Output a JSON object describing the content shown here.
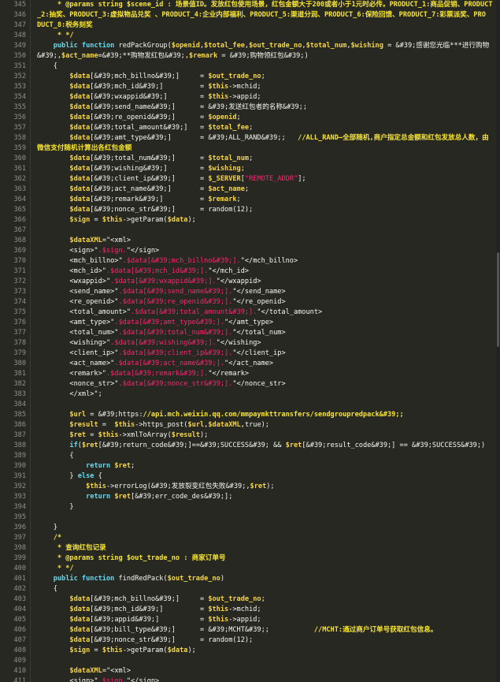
{
  "colors": {
    "background": "#272822",
    "line_number": "#8f908a",
    "default": "#f8f8f2",
    "comment": "#f8e531",
    "keyword": "#66d9ef",
    "variable": "#f5d547",
    "string": "#e6db74",
    "function": "#a6e22e",
    "red": "#f92672",
    "green": "#3bd35e",
    "blue_url": "#66d9ef",
    "constant": "#ae81ff"
  },
  "lines": [
    {
      "n": "345",
      "t": [
        [
          "comment",
          "     * @params string $scene_id : 场景值ID。发放红包使用场景，红包金额大于200或者小于1元时必传。PRODUCT_1:商品促销、PRODUCT"
        ]
      ]
    },
    {
      "n": "346",
      "t": [
        [
          "comment",
          "_2:抽奖、PRODUCT_3:虚拟物品兑奖 、PRODUCT_4:企业内部福利、PRODUCT_5:渠道分润、PRODUCT_6:保险回馈、PRODUCT_7:彩票派奖、PRO"
        ]
      ]
    },
    {
      "n": "347",
      "t": [
        [
          "comment",
          "DUCT_8:税务刻奖"
        ]
      ]
    },
    {
      "n": "348",
      "t": [
        [
          "comment",
          "     * */"
        ]
      ]
    },
    {
      "n": "349",
      "t": [
        [
          "default",
          "    "
        ],
        [
          "keyword",
          "public function "
        ],
        [
          "default",
          "redPackGroup("
        ],
        [
          "variable",
          "$openid"
        ],
        [
          "default",
          ","
        ],
        [
          "variable",
          "$total_fee"
        ],
        [
          "default",
          ","
        ],
        [
          "variable",
          "$out_trade_no"
        ],
        [
          "default",
          ","
        ],
        [
          "variable",
          "$total_num"
        ],
        [
          "default",
          ","
        ],
        [
          "variable",
          "$wishing"
        ],
        [
          "default",
          " = &#39;感谢您光临***进行购物"
        ]
      ]
    },
    {
      "n": "350",
      "t": [
        [
          "default",
          "&#39;,"
        ],
        [
          "variable",
          "$act_name"
        ],
        [
          "default",
          "=&#39;**购物发红包&#39;,"
        ],
        [
          "variable",
          "$remark"
        ],
        [
          "default",
          " = &#39;购物领红包&#39;)"
        ]
      ]
    },
    {
      "n": "351",
      "t": [
        [
          "default",
          "    {"
        ]
      ]
    },
    {
      "n": "352",
      "t": [
        [
          "default",
          "        "
        ],
        [
          "variable",
          "$data"
        ],
        [
          "default",
          "[&#39;mch_billno&#39;]     = "
        ],
        [
          "variable",
          "$out_trade_no"
        ],
        [
          "default",
          ";"
        ]
      ]
    },
    {
      "n": "353",
      "t": [
        [
          "default",
          "        "
        ],
        [
          "variable",
          "$data"
        ],
        [
          "default",
          "[&#39;mch_id&#39;]         = "
        ],
        [
          "variable",
          "$this"
        ],
        [
          "default",
          "->mchid;"
        ]
      ]
    },
    {
      "n": "354",
      "t": [
        [
          "default",
          "        "
        ],
        [
          "variable",
          "$data"
        ],
        [
          "default",
          "[&#39;wxappid&#39;]        = "
        ],
        [
          "variable",
          "$this"
        ],
        [
          "default",
          "->appid;"
        ]
      ]
    },
    {
      "n": "355",
      "t": [
        [
          "default",
          "        "
        ],
        [
          "variable",
          "$data"
        ],
        [
          "default",
          "[&#39;send_name&#39;]      = &#39;发送红包者的名称&#39;;"
        ]
      ]
    },
    {
      "n": "356",
      "t": [
        [
          "default",
          "        "
        ],
        [
          "variable",
          "$data"
        ],
        [
          "default",
          "[&#39;re_openid&#39;]      = "
        ],
        [
          "variable",
          "$openid"
        ],
        [
          "default",
          ";"
        ]
      ]
    },
    {
      "n": "357",
      "t": [
        [
          "default",
          "        "
        ],
        [
          "variable",
          "$data"
        ],
        [
          "default",
          "[&#39;total_amount&#39;]   = "
        ],
        [
          "variable",
          "$total_fee"
        ],
        [
          "default",
          ";"
        ]
      ]
    },
    {
      "n": "358",
      "t": [
        [
          "default",
          "        "
        ],
        [
          "variable",
          "$data"
        ],
        [
          "default",
          "[&#39;amt_type&#39;]       = &#39;ALL_RAND&#39;;   "
        ],
        [
          "comment",
          "//ALL_RAND—全部随机,商户指定总金额和红包发放总人数，由"
        ]
      ]
    },
    {
      "n": "359",
      "t": [
        [
          "comment",
          "微信支付随机计算出各红包金额"
        ]
      ]
    },
    {
      "n": "360",
      "t": [
        [
          "default",
          "        "
        ],
        [
          "variable",
          "$data"
        ],
        [
          "default",
          "[&#39;total_num&#39;]      = "
        ],
        [
          "variable",
          "$total_num"
        ],
        [
          "default",
          ";"
        ]
      ]
    },
    {
      "n": "361",
      "t": [
        [
          "default",
          "        "
        ],
        [
          "variable",
          "$data"
        ],
        [
          "default",
          "[&#39;wishing&#39;]        = "
        ],
        [
          "variable",
          "$wishing"
        ],
        [
          "default",
          ";"
        ]
      ]
    },
    {
      "n": "362",
      "t": [
        [
          "default",
          "        "
        ],
        [
          "variable",
          "$data"
        ],
        [
          "default",
          "[&#39;client_ip&#39;]      = "
        ],
        [
          "variable",
          "$_SERVER"
        ],
        [
          "default",
          "["
        ],
        [
          "red",
          "\"REMOTE_ADDR\""
        ],
        [
          "default",
          "];"
        ]
      ]
    },
    {
      "n": "363",
      "t": [
        [
          "default",
          "        "
        ],
        [
          "variable",
          "$data"
        ],
        [
          "default",
          "[&#39;act_name&#39;]       = "
        ],
        [
          "variable",
          "$act_name"
        ],
        [
          "default",
          ";"
        ]
      ]
    },
    {
      "n": "364",
      "t": [
        [
          "default",
          "        "
        ],
        [
          "variable",
          "$data"
        ],
        [
          "default",
          "[&#39;remark&#39;]         = "
        ],
        [
          "variable",
          "$remark"
        ],
        [
          "default",
          ";"
        ]
      ]
    },
    {
      "n": "365",
      "t": [
        [
          "default",
          "        "
        ],
        [
          "variable",
          "$data"
        ],
        [
          "default",
          "[&#39;nonce_str&#39;]      = random(12);"
        ]
      ]
    },
    {
      "n": "366",
      "t": [
        [
          "default",
          "        "
        ],
        [
          "variable",
          "$sign"
        ],
        [
          "default",
          " = "
        ],
        [
          "variable",
          "$this"
        ],
        [
          "default",
          "->getParam("
        ],
        [
          "variable",
          "$data"
        ],
        [
          "default",
          ");"
        ]
      ]
    },
    {
      "n": "367",
      "t": [
        [
          "default",
          ""
        ]
      ]
    },
    {
      "n": "368",
      "t": [
        [
          "default",
          "        "
        ],
        [
          "variable",
          "$dataXML"
        ],
        [
          "default",
          "=\"<xml>"
        ]
      ]
    },
    {
      "n": "369",
      "t": [
        [
          "default",
          "        <sign>\""
        ],
        [
          "red",
          ".$sign."
        ],
        [
          "default",
          "\"</sign>"
        ]
      ]
    },
    {
      "n": "370",
      "t": [
        [
          "default",
          "        <mch_billno>\""
        ],
        [
          "red",
          ".$data[&#39;mch_billno&#39;]."
        ],
        [
          "default",
          "\"</mch_billno>"
        ]
      ]
    },
    {
      "n": "371",
      "t": [
        [
          "default",
          "        <mch_id>\""
        ],
        [
          "red",
          ".$data[&#39;mch_id&#39;]."
        ],
        [
          "default",
          "\"</mch_id>"
        ]
      ]
    },
    {
      "n": "372",
      "t": [
        [
          "default",
          "        <wxappid>\""
        ],
        [
          "red",
          ".$data[&#39;wxappid&#39;]."
        ],
        [
          "default",
          "\"</wxappid>"
        ]
      ]
    },
    {
      "n": "373",
      "t": [
        [
          "default",
          "        <send_name>\""
        ],
        [
          "red",
          ".$data[&#39;send_name&#39;]."
        ],
        [
          "default",
          "\"</send_name>"
        ]
      ]
    },
    {
      "n": "374",
      "t": [
        [
          "default",
          "        <re_openid>\""
        ],
        [
          "red",
          ".$data[&#39;re_openid&#39;]."
        ],
        [
          "default",
          "\"</re_openid>"
        ]
      ]
    },
    {
      "n": "375",
      "t": [
        [
          "default",
          "        <total_amount>\""
        ],
        [
          "red",
          ".$data[&#39;total_amount&#39;]."
        ],
        [
          "default",
          "\"</total_amount>"
        ]
      ]
    },
    {
      "n": "376",
      "t": [
        [
          "default",
          "        <amt_type>\""
        ],
        [
          "red",
          ".$data[&#39;amt_type&#39;]."
        ],
        [
          "default",
          "\"</amt_type>"
        ]
      ]
    },
    {
      "n": "377",
      "t": [
        [
          "default",
          "        <total_num>\""
        ],
        [
          "red",
          ".$data[&#39;total_num&#39;]."
        ],
        [
          "default",
          "\"</total_num>"
        ]
      ]
    },
    {
      "n": "378",
      "t": [
        [
          "default",
          "        <wishing>\""
        ],
        [
          "red",
          ".$data[&#39;wishing&#39;]."
        ],
        [
          "default",
          "\"</wishing>"
        ]
      ]
    },
    {
      "n": "379",
      "t": [
        [
          "default",
          "        <client_ip>\""
        ],
        [
          "red",
          ".$data[&#39;client_ip&#39;]."
        ],
        [
          "default",
          "\"</client_ip>"
        ]
      ]
    },
    {
      "n": "380",
      "t": [
        [
          "default",
          "        <act_name>\""
        ],
        [
          "red",
          ".$data[&#39;act_name&#39;]."
        ],
        [
          "default",
          "\"</act_name>"
        ]
      ]
    },
    {
      "n": "381",
      "t": [
        [
          "default",
          "        <remark>\""
        ],
        [
          "red",
          ".$data[&#39;remark&#39;]."
        ],
        [
          "default",
          "\"</remark>"
        ]
      ]
    },
    {
      "n": "382",
      "t": [
        [
          "default",
          "        <nonce_str>\""
        ],
        [
          "red",
          ".$data[&#39;nonce_str&#39;]."
        ],
        [
          "default",
          "\"</nonce_str>"
        ]
      ]
    },
    {
      "n": "383",
      "t": [
        [
          "default",
          "        </xml>\";"
        ]
      ]
    },
    {
      "n": "384",
      "t": [
        [
          "default",
          ""
        ]
      ]
    },
    {
      "n": "385",
      "t": [
        [
          "default",
          "        "
        ],
        [
          "variable",
          "$url"
        ],
        [
          "default",
          " = &#39;https:"
        ],
        [
          "comment",
          "//api.mch.weixin.qq.com/mmpaymkttransfers/sendgroupredpack&#39;;"
        ]
      ]
    },
    {
      "n": "386",
      "t": [
        [
          "default",
          "        "
        ],
        [
          "variable",
          "$result"
        ],
        [
          "default",
          " =  "
        ],
        [
          "variable",
          "$this"
        ],
        [
          "default",
          "->https_post("
        ],
        [
          "variable",
          "$url"
        ],
        [
          "default",
          ","
        ],
        [
          "variable",
          "$dataXML"
        ],
        [
          "default",
          ",true);"
        ]
      ]
    },
    {
      "n": "387",
      "t": [
        [
          "default",
          "        "
        ],
        [
          "variable",
          "$ret"
        ],
        [
          "default",
          " = "
        ],
        [
          "variable",
          "$this"
        ],
        [
          "default",
          "->xmlToArray("
        ],
        [
          "variable",
          "$result"
        ],
        [
          "default",
          ");"
        ]
      ]
    },
    {
      "n": "388",
      "t": [
        [
          "default",
          "        "
        ],
        [
          "keyword",
          "if"
        ],
        [
          "default",
          "("
        ],
        [
          "variable",
          "$ret"
        ],
        [
          "default",
          "[&#39;return_code&#39;]==&#39;SUCCESS&#39; && "
        ],
        [
          "variable",
          "$ret"
        ],
        [
          "default",
          "[&#39;result_code&#39;] == &#39;SUCCESS&#39;)"
        ]
      ]
    },
    {
      "n": "389",
      "t": [
        [
          "default",
          "        {"
        ]
      ]
    },
    {
      "n": "390",
      "t": [
        [
          "default",
          "            "
        ],
        [
          "keyword",
          "return "
        ],
        [
          "variable",
          "$ret"
        ],
        [
          "default",
          ";"
        ]
      ]
    },
    {
      "n": "391",
      "t": [
        [
          "default",
          "        } "
        ],
        [
          "keyword",
          "else"
        ],
        [
          "default",
          " {"
        ]
      ]
    },
    {
      "n": "392",
      "t": [
        [
          "default",
          "            "
        ],
        [
          "variable",
          "$this"
        ],
        [
          "default",
          "->errorLog(&#39;发放裂变红包失败&#39;,"
        ],
        [
          "variable",
          "$ret"
        ],
        [
          "default",
          ");"
        ]
      ]
    },
    {
      "n": "393",
      "t": [
        [
          "default",
          "            "
        ],
        [
          "keyword",
          "return "
        ],
        [
          "variable",
          "$ret"
        ],
        [
          "default",
          "[&#39;err_code_des&#39;];"
        ]
      ]
    },
    {
      "n": "394",
      "t": [
        [
          "default",
          "        }"
        ]
      ]
    },
    {
      "n": "395",
      "t": [
        [
          "default",
          ""
        ]
      ]
    },
    {
      "n": "396",
      "t": [
        [
          "default",
          "    }"
        ]
      ]
    },
    {
      "n": "397",
      "t": [
        [
          "default",
          "    "
        ],
        [
          "comment",
          "/*"
        ]
      ]
    },
    {
      "n": "398",
      "t": [
        [
          "comment",
          "     * 查询红包记录"
        ]
      ]
    },
    {
      "n": "399",
      "t": [
        [
          "comment",
          "     * @params string $out_trade_no : 商家订单号"
        ]
      ]
    },
    {
      "n": "400",
      "t": [
        [
          "comment",
          "     * */"
        ]
      ]
    },
    {
      "n": "401",
      "t": [
        [
          "default",
          "    "
        ],
        [
          "keyword",
          "public function "
        ],
        [
          "default",
          "findRedPack("
        ],
        [
          "variable",
          "$out_trade_no"
        ],
        [
          "default",
          ")"
        ]
      ]
    },
    {
      "n": "402",
      "t": [
        [
          "default",
          "    {"
        ]
      ]
    },
    {
      "n": "403",
      "t": [
        [
          "default",
          "        "
        ],
        [
          "variable",
          "$data"
        ],
        [
          "default",
          "[&#39;mch_billno&#39;]     = "
        ],
        [
          "variable",
          "$out_trade_no"
        ],
        [
          "default",
          ";"
        ]
      ]
    },
    {
      "n": "404",
      "t": [
        [
          "default",
          "        "
        ],
        [
          "variable",
          "$data"
        ],
        [
          "default",
          "[&#39;mch_id&#39;]         = "
        ],
        [
          "variable",
          "$this"
        ],
        [
          "default",
          "->mchid;"
        ]
      ]
    },
    {
      "n": "405",
      "t": [
        [
          "default",
          "        "
        ],
        [
          "variable",
          "$data"
        ],
        [
          "default",
          "[&#39;appid&#39;]          = "
        ],
        [
          "variable",
          "$this"
        ],
        [
          "default",
          "->appid;"
        ]
      ]
    },
    {
      "n": "406",
      "t": [
        [
          "default",
          "        "
        ],
        [
          "variable",
          "$data"
        ],
        [
          "default",
          "[&#39;bill_type&#39;]      = &#39;MCHT&#39;;           "
        ],
        [
          "comment",
          "//MCHT:通过商户订单号获取红包信息。"
        ]
      ]
    },
    {
      "n": "407",
      "t": [
        [
          "default",
          "        "
        ],
        [
          "variable",
          "$data"
        ],
        [
          "default",
          "[&#39;nonce_str&#39;]      = random(12);"
        ]
      ]
    },
    {
      "n": "408",
      "t": [
        [
          "default",
          "        "
        ],
        [
          "variable",
          "$sign"
        ],
        [
          "default",
          " = "
        ],
        [
          "variable",
          "$this"
        ],
        [
          "default",
          "->getParam("
        ],
        [
          "variable",
          "$data"
        ],
        [
          "default",
          ");"
        ]
      ]
    },
    {
      "n": "409",
      "t": [
        [
          "default",
          ""
        ]
      ]
    },
    {
      "n": "410",
      "t": [
        [
          "default",
          "        "
        ],
        [
          "variable",
          "$dataXML"
        ],
        [
          "default",
          "=\"<xml>"
        ]
      ]
    },
    {
      "n": "411",
      "t": [
        [
          "default",
          "        <sign>\""
        ],
        [
          "red",
          ".$sign."
        ],
        [
          "default",
          "\"</sign>"
        ]
      ]
    }
  ]
}
